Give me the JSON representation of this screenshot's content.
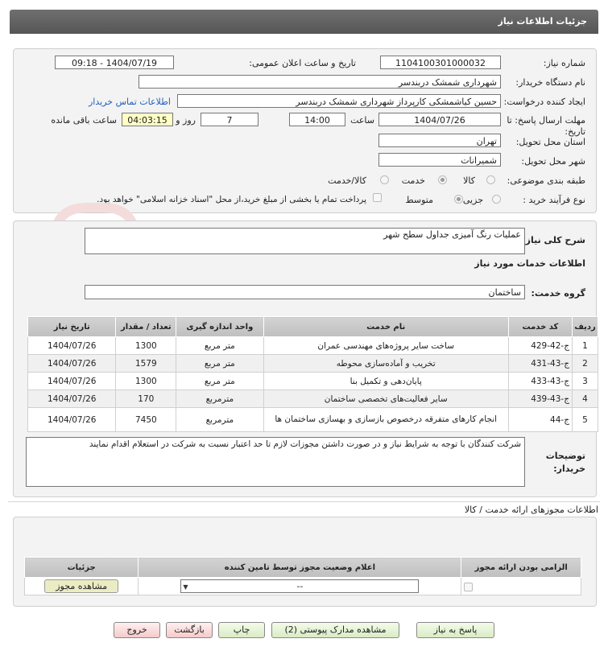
{
  "header": {
    "title": "جزئیات اطلاعات نیاز"
  },
  "form": {
    "need_number_label": "شماره نیاز:",
    "need_number": "1104100301000032",
    "announce_label": "تاریخ و ساعت اعلان عمومی:",
    "announce_value": "1404/07/19 - 09:18",
    "buyer_org_label": "نام دستگاه خریدار:",
    "buyer_org": "شهرداری شمشک دربندسر",
    "requester_label": "ایجاد کننده درخواست:",
    "requester": "حسین کیاشمشکی کارپرداز شهرداری شمشک دربندسر",
    "contact_link": "اطلاعات تماس خریدار",
    "deadline_label_1": "مهلت ارسال پاسخ: تا",
    "deadline_label_2": "تاریخ:",
    "deadline_date": "1404/07/26",
    "time_label": "ساعت",
    "deadline_time": "14:00",
    "days_value": "7",
    "days_label": "روز و",
    "remaining_time": "04:03:15",
    "remaining_label": "ساعت باقی مانده",
    "province_label": "استان محل تحویل:",
    "province": "تهران",
    "city_label": "شهر محل تحویل:",
    "city": "شمیرانات",
    "category_label": "طبقه بندی موضوعی:",
    "category_options": [
      "کالا",
      "خدمت",
      "کالا/خدمت"
    ],
    "process_label": "نوع فرآیند خرید :",
    "process_options": [
      "جزیی",
      "متوسط"
    ],
    "payment_note": "پرداخت تمام یا بخشی از مبلغ خرید،از محل \"اسناد خزانه اسلامی\" خواهد بود."
  },
  "summary": {
    "label": "شرح کلی نیاز:",
    "value": "عملیات رنگ آمیزی جداول سطح شهر"
  },
  "services": {
    "section_title": "اطلاعات خدمات مورد نیاز",
    "group_label": "گروه خدمت:",
    "group_value": "ساختمان",
    "columns": [
      "ردیف",
      "کد خدمت",
      "نام خدمت",
      "واحد اندازه گیری",
      "تعداد / مقدار",
      "تاریخ نیاز"
    ],
    "rows": [
      [
        "1",
        "ج-42-429",
        "ساخت سایر پروژه‌های مهندسی عمران",
        "متر مربع",
        "1300",
        "1404/07/26"
      ],
      [
        "2",
        "ج-43-431",
        "تخریب و آماده‌سازی محوطه",
        "متر مربع",
        "1579",
        "1404/07/26"
      ],
      [
        "3",
        "ج-43-433",
        "پایان‌دهی و تکمیل بنا",
        "متر مربع",
        "1300",
        "1404/07/26"
      ],
      [
        "4",
        "ج-43-439",
        "سایر فعالیت‌های تخصصی ساختمان",
        "مترمربع",
        "170",
        "1404/07/26"
      ],
      [
        "5",
        "ج-44",
        "انجام کارهای متفرقه درخصوص بازسازی و بهسازی ساختمان ها",
        "مترمربع",
        "7450",
        "1404/07/26"
      ]
    ]
  },
  "buyer_notes": {
    "label_1": "توضیحات",
    "label_2": "خریدار:",
    "value": "شرکت کنندگان با توجه به شرایط نیاز و در صورت داشتن مجوزات لازم تا حد اعتبار نسبت به شرکت در استعلام اقدام نمایند"
  },
  "permits": {
    "title": "اطلاعات مجوزهای ارائه خدمت / کالا",
    "columns": [
      "الزامی بودن ارائه مجوز",
      "اعلام وضعیت مجوز توسط تامین کننده",
      "جزئیات"
    ],
    "select_value": "--",
    "view_button": "مشاهده مجوز"
  },
  "buttons": {
    "reply": "پاسخ به نیاز",
    "attachments": "مشاهده مدارک پیوستی (2)",
    "print": "چاپ",
    "back": "بازگشت",
    "exit": "خروج"
  },
  "colors": {
    "header_bg": "#606060",
    "panel_bg": "#f3f3f3",
    "link": "#1f5fbf",
    "highlight": "#ffffc6"
  }
}
